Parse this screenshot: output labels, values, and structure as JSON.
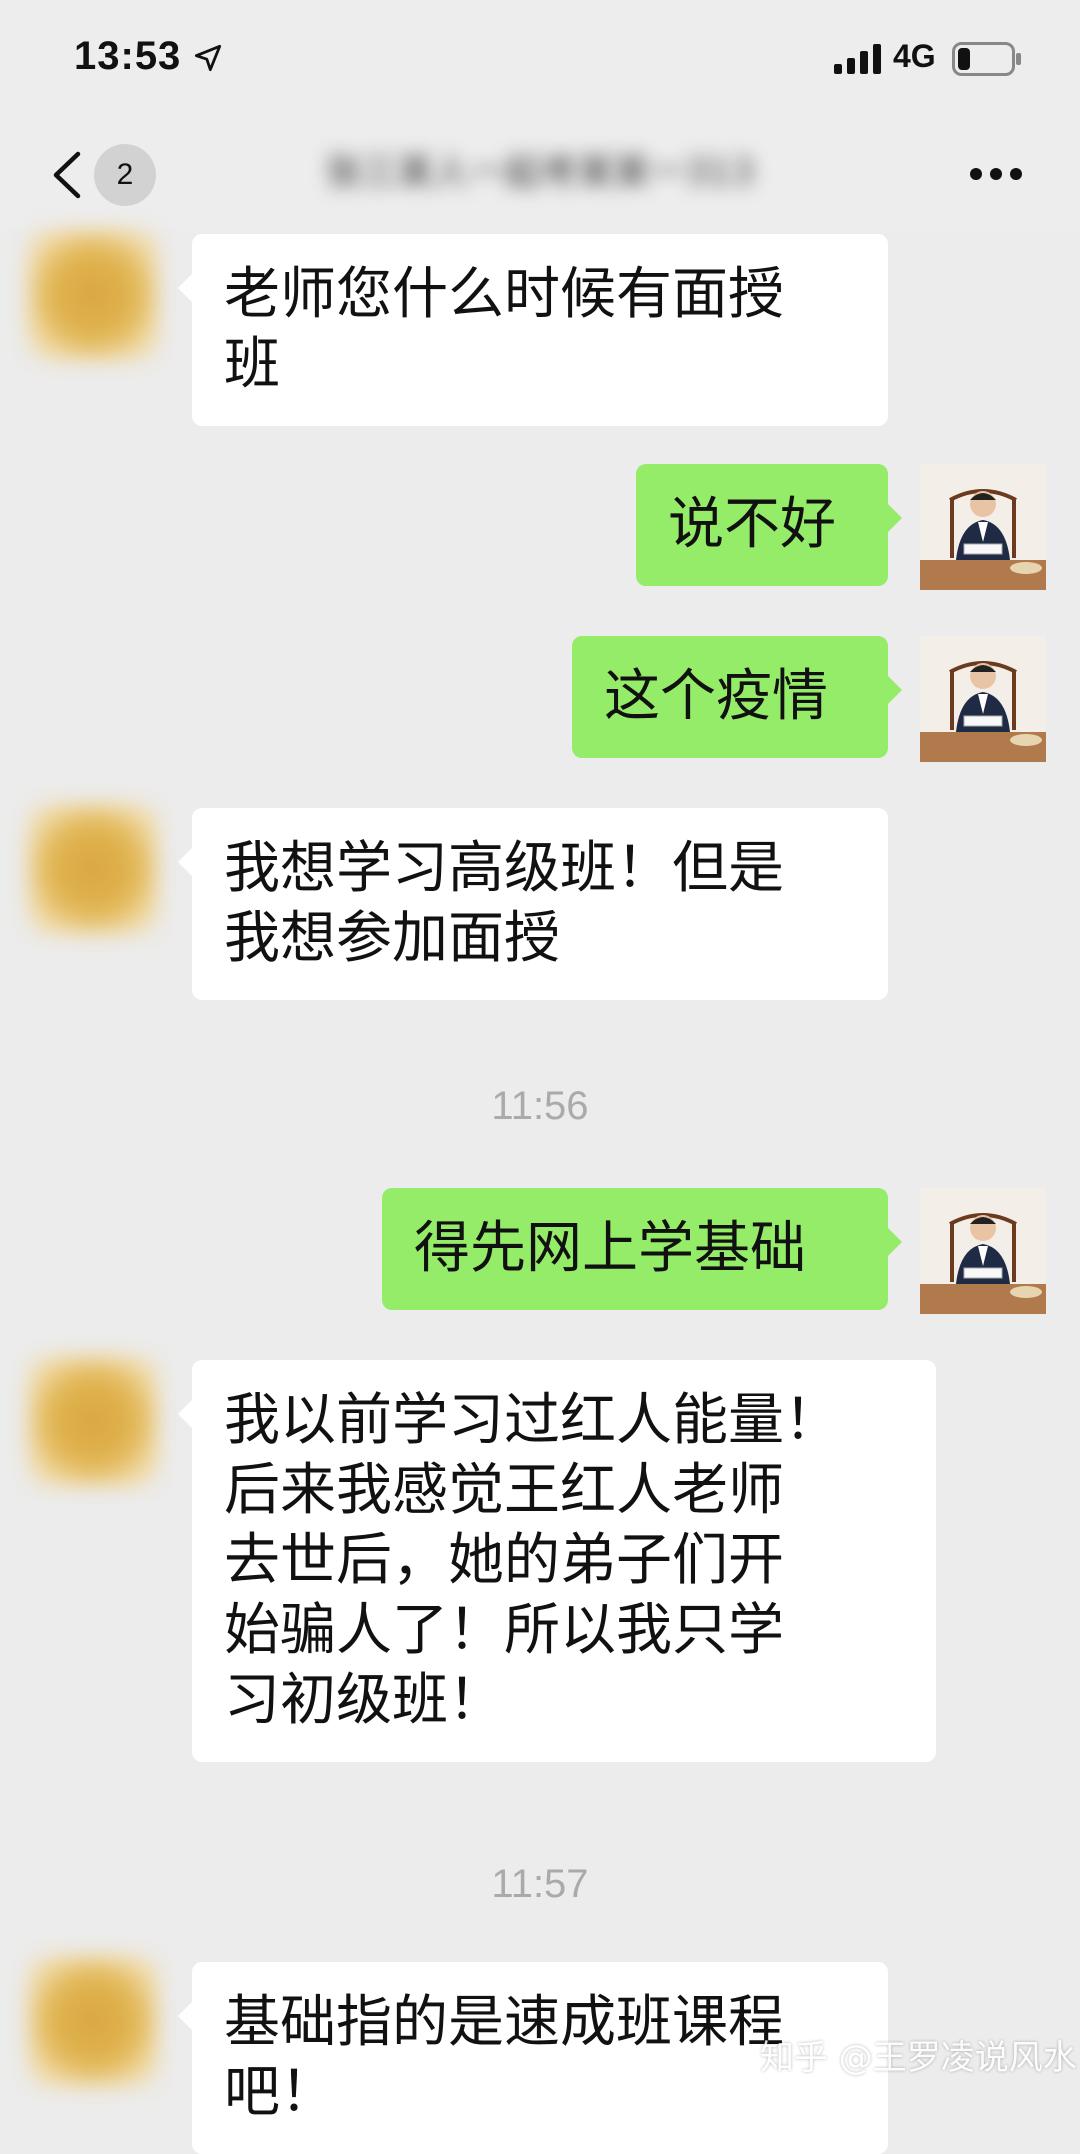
{
  "status_bar": {
    "time": "13:53",
    "network": "4G",
    "icons": [
      "location-arrow-icon",
      "signal-icon",
      "battery-icon"
    ]
  },
  "nav": {
    "unread_count": "2",
    "title_blurred": "张三某人一起考某某一313",
    "icons": [
      "chevron-left-icon",
      "more-icon"
    ]
  },
  "messages": [
    {
      "side": "left",
      "text": "老师您什么时候有面授\n班"
    },
    {
      "side": "right",
      "text": "说不好"
    },
    {
      "side": "right",
      "text": "这个疫情"
    },
    {
      "side": "left",
      "text": "我想学习高级班！但是\n我想参加面授"
    },
    {
      "side": "right",
      "text": "得先网上学基础"
    },
    {
      "side": "left",
      "text": "我以前学习过红人能量！\n后来我感觉王红人老师\n去世后，她的弟子们开\n始骗人了！所以我只学\n习初级班！"
    },
    {
      "side": "left",
      "text": "基础指的是速成班课程\n吧！"
    }
  ],
  "timestamps": [
    "11:56",
    "11:57"
  ],
  "watermark": "知乎 @王罗凌说风水",
  "colors": {
    "background": "#ececec",
    "sent_bubble": "#95ec69",
    "received_bubble": "#ffffff",
    "timestamp": "#aaaaaa"
  }
}
